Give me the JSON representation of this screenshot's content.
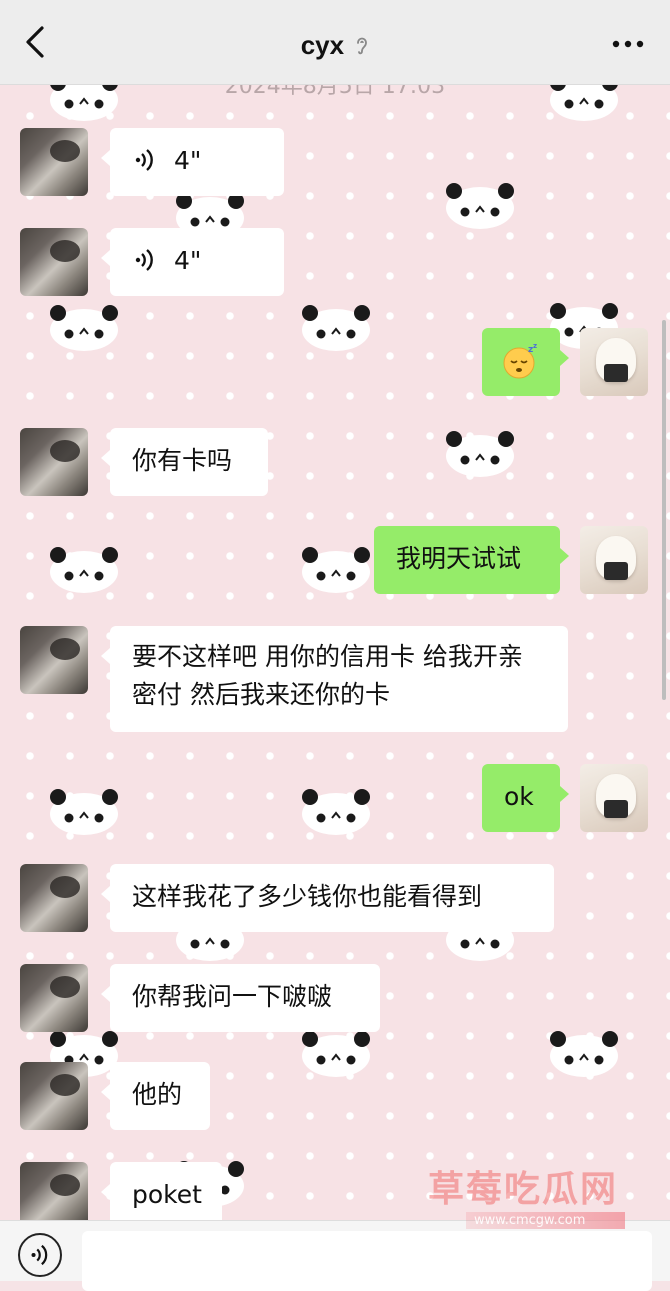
{
  "header": {
    "title": "cyx",
    "timestamp": "2024年8月5日 17:03"
  },
  "messages": [
    {
      "side": "left",
      "type": "voice",
      "text": "4\""
    },
    {
      "side": "left",
      "type": "voice",
      "text": "4\""
    },
    {
      "side": "right",
      "type": "emoji",
      "icon": "sleeping-face-emoji"
    },
    {
      "side": "left",
      "type": "text",
      "text": "你有卡吗"
    },
    {
      "side": "right",
      "type": "text",
      "text": "我明天试试"
    },
    {
      "side": "left",
      "type": "text",
      "text": "要不这样吧 用你的信用卡 给我开亲密付 然后我来还你的卡"
    },
    {
      "side": "right",
      "type": "text",
      "text": "ok"
    },
    {
      "side": "left",
      "type": "text",
      "text": "这样我花了多少钱你也能看得到"
    },
    {
      "side": "left",
      "type": "text",
      "text": "你帮我问一下啵啵"
    },
    {
      "side": "left",
      "type": "text",
      "text": "他的"
    },
    {
      "side": "left",
      "type": "text",
      "text": "poket"
    }
  ],
  "watermark": {
    "text": "草莓吃瓜网",
    "url": "www.cmcgw.com"
  },
  "colors": {
    "header_bg": "#ededed",
    "chat_bg": "#f7e2e5",
    "my_bubble": "#95ec69",
    "their_bubble": "#ffffff"
  }
}
